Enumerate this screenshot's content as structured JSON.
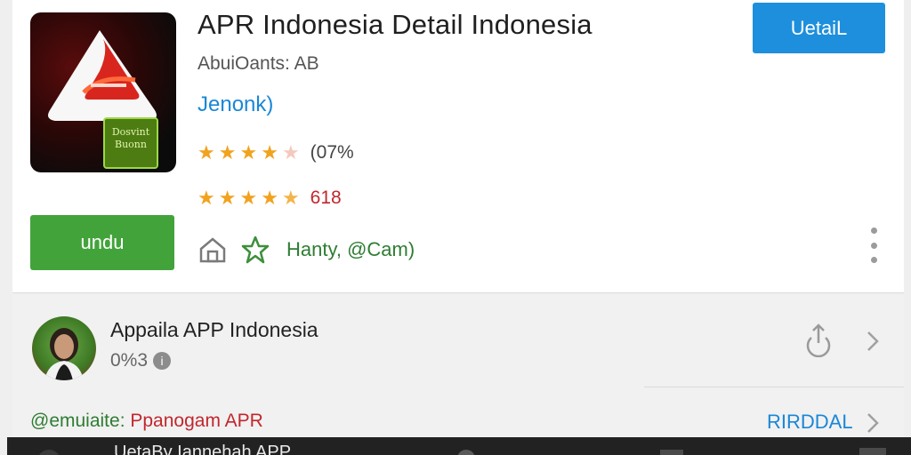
{
  "app": {
    "title": "APR Indonesia Detail Indonesia",
    "developer": "AbuiOants: AB",
    "category": "Jenonk)",
    "icon_badge_line1": "Dosvint",
    "icon_badge_line2": "Buonn",
    "rating1": {
      "stars": 4.5,
      "text": "(07%"
    },
    "rating2": {
      "stars": 4.5,
      "text": "618"
    },
    "meta_text": "Hanty, @Cam)",
    "detail_button": "UetaiL",
    "install_button": "undu"
  },
  "publisher": {
    "name": "Appaila APP Indonesia",
    "count": "0%3",
    "info_icon_glyph": "i"
  },
  "footer": {
    "left_prefix": "@emuiaite:",
    "left_value": "Ppanogam APR",
    "right_link": "RIRDDAL"
  },
  "bottom_bar": {
    "text": "UetaBy Iannehah APP"
  },
  "icons": [
    "house-icon",
    "star-outline-icon",
    "more-vert-icon",
    "share-icon",
    "chevron-right-icon",
    "info-icon"
  ],
  "colors": {
    "primary_blue": "#1e8fdc",
    "install_green": "#43a33b",
    "star_orange": "#f1a21e",
    "accent_red": "#c1272d",
    "meta_green": "#2e7d32"
  }
}
